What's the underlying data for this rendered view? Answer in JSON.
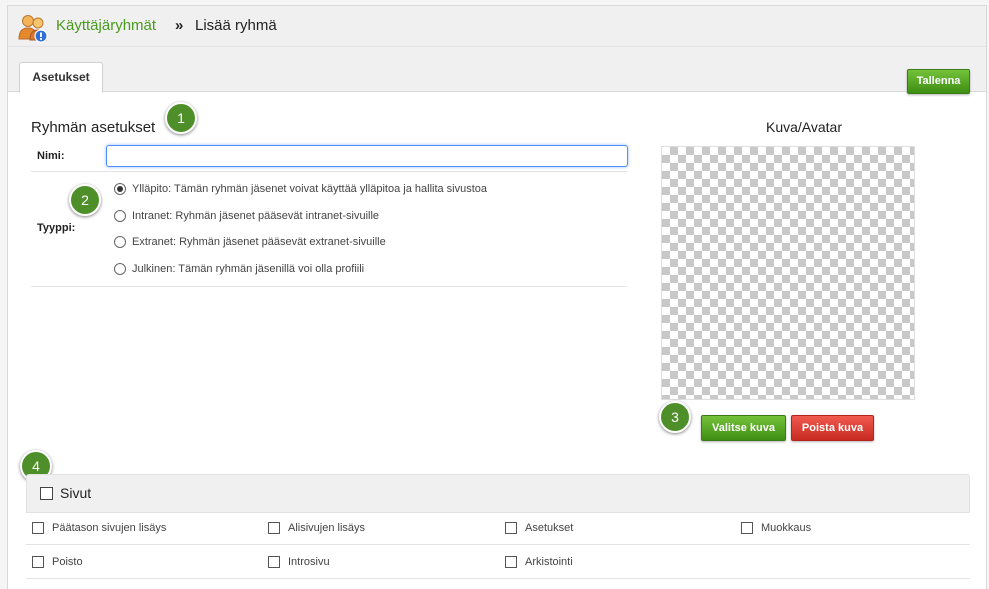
{
  "breadcrumb": {
    "root": "Käyttäjäryhmät",
    "separator": "»",
    "current": "Lisää ryhmä"
  },
  "tabs": [
    {
      "label": "Asetukset"
    }
  ],
  "toolbar": {
    "save_label": "Tallenna"
  },
  "settings": {
    "title": "Ryhmän asetukset",
    "name_label": "Nimi:",
    "name_value": "",
    "type_label": "Tyyppi:",
    "types": [
      {
        "label": "Ylläpito: Tämän ryhmän jäsenet voivat käyttää ylläpitoa ja hallita sivustoa",
        "selected": true
      },
      {
        "label": "Intranet: Ryhmän jäsenet pääsevät intranet-sivuille",
        "selected": false
      },
      {
        "label": "Extranet: Ryhmän jäsenet pääsevät extranet-sivuille",
        "selected": false
      },
      {
        "label": "Julkinen: Tämän ryhmän jäsenillä voi olla profiili",
        "selected": false
      }
    ]
  },
  "avatar": {
    "title": "Kuva/Avatar",
    "choose_label": "Valitse kuva",
    "remove_label": "Poista kuva"
  },
  "badges": [
    "1",
    "2",
    "3",
    "4"
  ],
  "pages": {
    "title": "Sivut",
    "permissions": [
      "Päätason sivujen lisäys",
      "Alisivujen lisäys",
      "Asetukset",
      "Muokkaus",
      "Poisto",
      "Introsivu",
      "Arkistointi"
    ]
  },
  "colors": {
    "accent_green": "#4a9a1f",
    "button_green": "#3e8e14",
    "button_red": "#c72a20",
    "badge": "#4e8f2a"
  },
  "icons": {
    "logo": "users-group-icon"
  }
}
